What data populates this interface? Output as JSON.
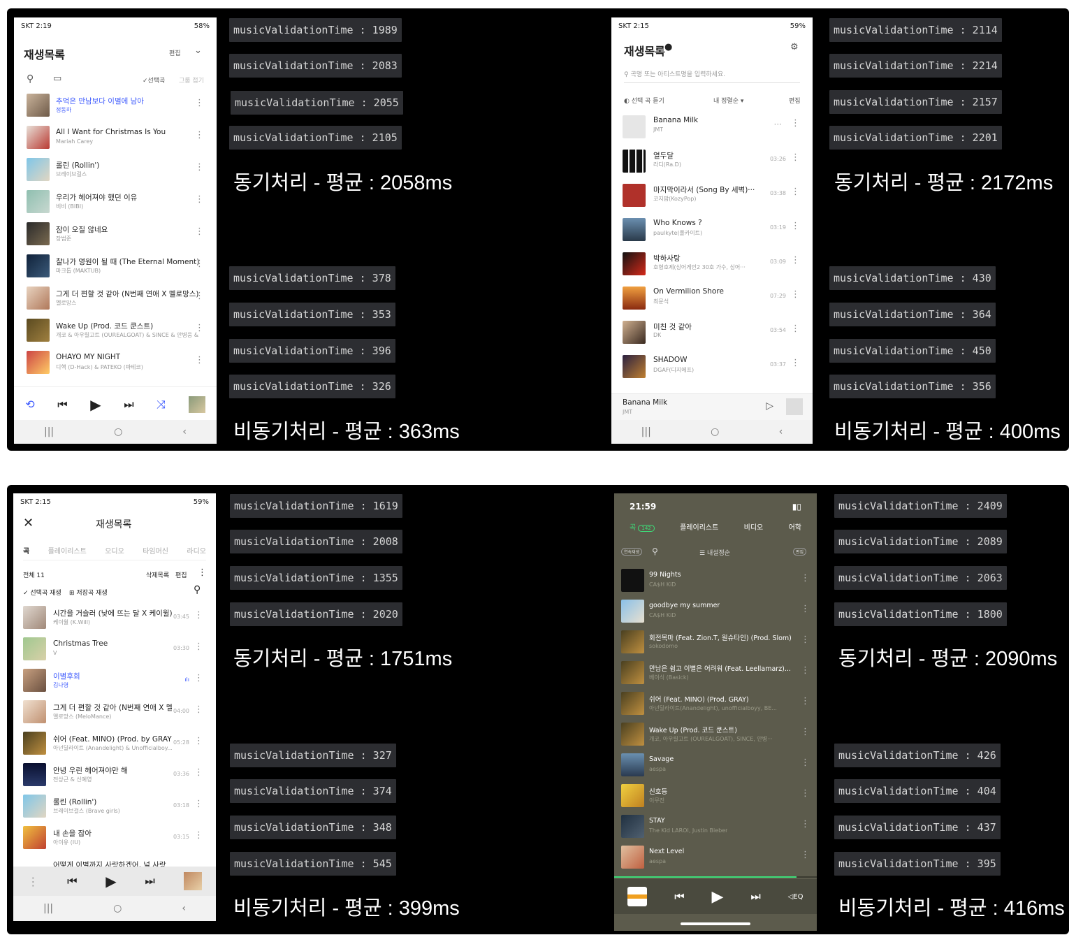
{
  "panels": [
    {
      "status_time": "SKT 2:19",
      "status_right": "58%",
      "title": "재생목록",
      "edit": "편집",
      "select_label": "✓선택곡",
      "fold_label": "그룹 접기",
      "songs": [
        {
          "title": "추억은 만남보다 이별에 남아",
          "artist": "정동하"
        },
        {
          "title": "All I Want for Christmas Is You",
          "artist": "Mariah Carey"
        },
        {
          "title": "롤린 (Rollin')",
          "artist": "브레이브걸스"
        },
        {
          "title": "우리가 헤어져야 했던 이유",
          "artist": "비비 (BIBI)"
        },
        {
          "title": "잠이 오질 않네요",
          "artist": "장범준"
        },
        {
          "title": "찰나가 영원이 될 때 (The Eternal Moment)",
          "artist": "마크툽 (MAKTUB)"
        },
        {
          "title": "그게 더 편할 것 같아 (N번째 연애 X 멜로망스)",
          "artist": "멜로망스"
        },
        {
          "title": "Wake Up (Prod. 코드 쿤스트)",
          "artist": "개코 & 아우릴고트 (OUREALGOAT) & SINCE & 안병웅 &..."
        },
        {
          "title": "OHAYO MY NIGHT",
          "artist": "디핵 (D-Hack) & PATEKO (파테코)"
        }
      ],
      "sync_times": [
        "musicValidationTime : 1989",
        "musicValidationTime : 2083",
        "musicValidationTime : 2055",
        "musicValidationTime : 2105"
      ],
      "sync_summary": "동기처리 - 평균 : 2058ms",
      "async_times": [
        "musicValidationTime : 378",
        "musicValidationTime : 353",
        "musicValidationTime : 396",
        "musicValidationTime : 326"
      ],
      "async_summary": "비동기처리 - 평균 : 363ms"
    },
    {
      "status_time": "SKT 2:15",
      "status_right": "59%",
      "title": "재생목록",
      "search_placeholder": "곡명 또는 아티스트명을 입력하세요.",
      "select_label": "선택 곡 듣기",
      "sort_label": "내 정렬순 ▾",
      "edit": "편집",
      "songs": [
        {
          "title": "Banana Milk",
          "artist": "JMT",
          "dur": ""
        },
        {
          "title": "열두달",
          "artist": "라디(Ra.D)",
          "dur": "03:26"
        },
        {
          "title": "마지막이라서 (Song By 세벽)···",
          "artist": "코지팝(KozyPop)",
          "dur": "03:38"
        },
        {
          "title": "Who Knows ?",
          "artist": "paulkyte(폴카이트)",
          "dur": "03:19"
        },
        {
          "title": "박하사탕",
          "artist": "호형호제(싱어게인2 30호 가수, 싱어···",
          "dur": "03:09"
        },
        {
          "title": "On Vermilion Shore",
          "artist": "최문석",
          "dur": "07:29"
        },
        {
          "title": "미친 것 같아",
          "artist": "DK",
          "dur": "03:54"
        },
        {
          "title": "SHADOW",
          "artist": "DGAF(디지에프)",
          "dur": "03:37"
        }
      ],
      "now_playing_title": "Banana Milk",
      "now_playing_artist": "JMT",
      "sync_times": [
        "musicValidationTime : 2114",
        "musicValidationTime : 2214",
        "musicValidationTime : 2157",
        "musicValidationTime : 2201"
      ],
      "sync_summary": "동기처리 - 평균 : 2172ms",
      "async_times": [
        "musicValidationTime : 430",
        "musicValidationTime : 364",
        "musicValidationTime : 450",
        "musicValidationTime : 356"
      ],
      "async_summary": "비동기처리 - 평균 : 400ms"
    },
    {
      "status_time": "SKT 2:15",
      "status_right": "59%",
      "title": "재생목록",
      "tabs": [
        "곡",
        "플레이리스트",
        "오디오",
        "타임머신",
        "라디오"
      ],
      "total_label": "전체 11",
      "delete_label": "삭제목록",
      "edit": "편집",
      "play_selected": "선택곡 재생",
      "play_saved": "저장곡 재생",
      "songs": [
        {
          "title": "시간을 거슬러 (낮에 뜨는 달 X 케이윌)",
          "artist": "케이윌 (K.Will)",
          "dur": "03:45"
        },
        {
          "title": "Christmas Tree",
          "artist": "V",
          "dur": "03:30"
        },
        {
          "title": "이별후회",
          "artist": "김나영",
          "dur": ""
        },
        {
          "title": "그게 더 편할 것 같아 (N번째 연애 X 멜...",
          "artist": "멜로망스 (MeloMance)",
          "dur": "04:00"
        },
        {
          "title": "쉬어 (Feat. MINO) (Prod. by GRAY)",
          "artist": "아넌딜라이트 (Anandelight) & Unofficialboy...",
          "dur": "05:28"
        },
        {
          "title": "안녕 우린 헤어져야만 해",
          "artist": "전상근 & 신예영",
          "dur": "03:36"
        },
        {
          "title": "롤린 (Rollin')",
          "artist": "브레이브걸스 (Brave girls)",
          "dur": "03:18"
        },
        {
          "title": "내 손을 잡아",
          "artist": "아이유 (IU)",
          "dur": "03:15"
        },
        {
          "title": "어떻게 이별까지 사랑하겠어, 널 사랑",
          "artist": "",
          "dur": ""
        }
      ],
      "sync_times": [
        "musicValidationTime : 1619",
        "musicValidationTime : 2008",
        "musicValidationTime : 1355",
        "musicValidationTime : 2020"
      ],
      "sync_summary": "동기처리 - 평균 : 1751ms",
      "async_times": [
        "musicValidationTime : 327",
        "musicValidationTime : 374",
        "musicValidationTime : 348",
        "musicValidationTime : 545"
      ],
      "async_summary": "비동기처리 - 평균 : 399ms"
    },
    {
      "status_time": "21:59",
      "tabs": [
        "곡",
        "플레이리스트",
        "비디오",
        "어학"
      ],
      "tab_count": "142",
      "continue_label": "연속재생",
      "sort_label": "내설정순",
      "edit": "편집",
      "songs": [
        {
          "title": "99 Nights",
          "artist": "CA$H KiD"
        },
        {
          "title": "goodbye my summer",
          "artist": "CA$H KiD"
        },
        {
          "title": "회전목마 (Feat. Zion.T, 원슈타인) (Prod. Slom)",
          "artist": "sokodomo"
        },
        {
          "title": "만남은 쉽고 이별은 어려워 (Feat. Leellamarz)...",
          "artist": "베이식 (Basick)"
        },
        {
          "title": "쉬어 (Feat. MINO) (Prod. GRAY)",
          "artist": "아넌딜라이트(Anandelight), unofficialboyy, BE..."
        },
        {
          "title": "Wake Up (Prod. 코드 쿤스트)",
          "artist": "개코, 아우릴고트 (OUREALGOAT), SINCE, 안병···"
        },
        {
          "title": "Savage",
          "artist": "aespa"
        },
        {
          "title": "신호등",
          "artist": "이무진"
        },
        {
          "title": "STAY",
          "artist": "The Kid LAROI, Justin Bieber"
        },
        {
          "title": "Next Level",
          "artist": "aespa"
        }
      ],
      "eq_label": "EQ",
      "sync_times": [
        "musicValidationTime : 2409",
        "musicValidationTime : 2089",
        "musicValidationTime : 2063",
        "musicValidationTime : 1800"
      ],
      "sync_summary": "동기처리 - 평균 : 2090ms",
      "async_times": [
        "musicValidationTime : 426",
        "musicValidationTime : 404",
        "musicValidationTime : 437",
        "musicValidationTime : 395"
      ],
      "async_summary": "비동기처리 - 평균 : 416ms"
    }
  ]
}
